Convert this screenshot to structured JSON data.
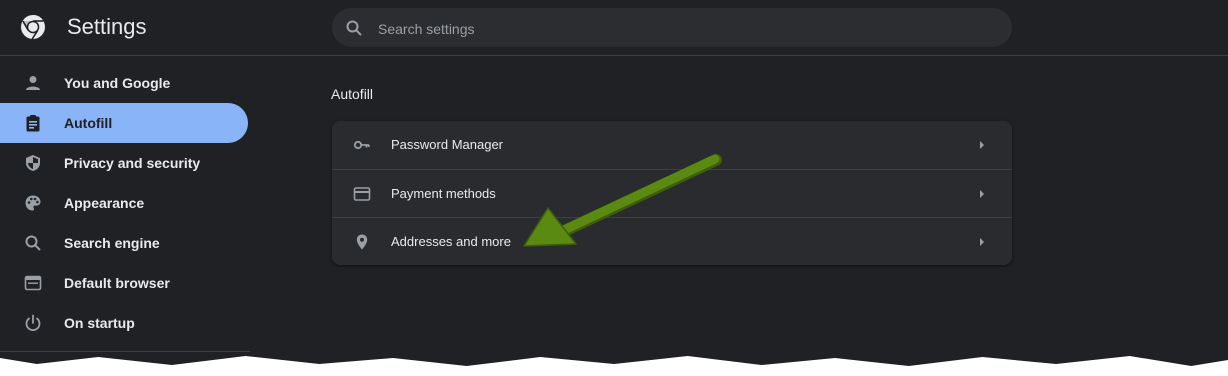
{
  "app": {
    "title": "Settings"
  },
  "search": {
    "placeholder": "Search settings"
  },
  "sidebar": {
    "items": [
      {
        "label": "You and Google",
        "icon": "person-icon",
        "active": false
      },
      {
        "label": "Autofill",
        "icon": "clipboard-icon",
        "active": true
      },
      {
        "label": "Privacy and security",
        "icon": "shield-icon",
        "active": false
      },
      {
        "label": "Appearance",
        "icon": "palette-icon",
        "active": false
      },
      {
        "label": "Search engine",
        "icon": "search-icon",
        "active": false
      },
      {
        "label": "Default browser",
        "icon": "browser-window-icon",
        "active": false
      },
      {
        "label": "On startup",
        "icon": "power-icon",
        "active": false
      }
    ]
  },
  "main": {
    "section_title": "Autofill",
    "rows": [
      {
        "label": "Password Manager",
        "icon": "key-icon"
      },
      {
        "label": "Payment methods",
        "icon": "credit-card-icon"
      },
      {
        "label": "Addresses and more",
        "icon": "location-pin-icon"
      }
    ]
  },
  "colors": {
    "background": "#202124",
    "active_nav": "#8ab4f8",
    "card": "#2a2b2e",
    "annotation_arrow": "#5a8a12"
  }
}
